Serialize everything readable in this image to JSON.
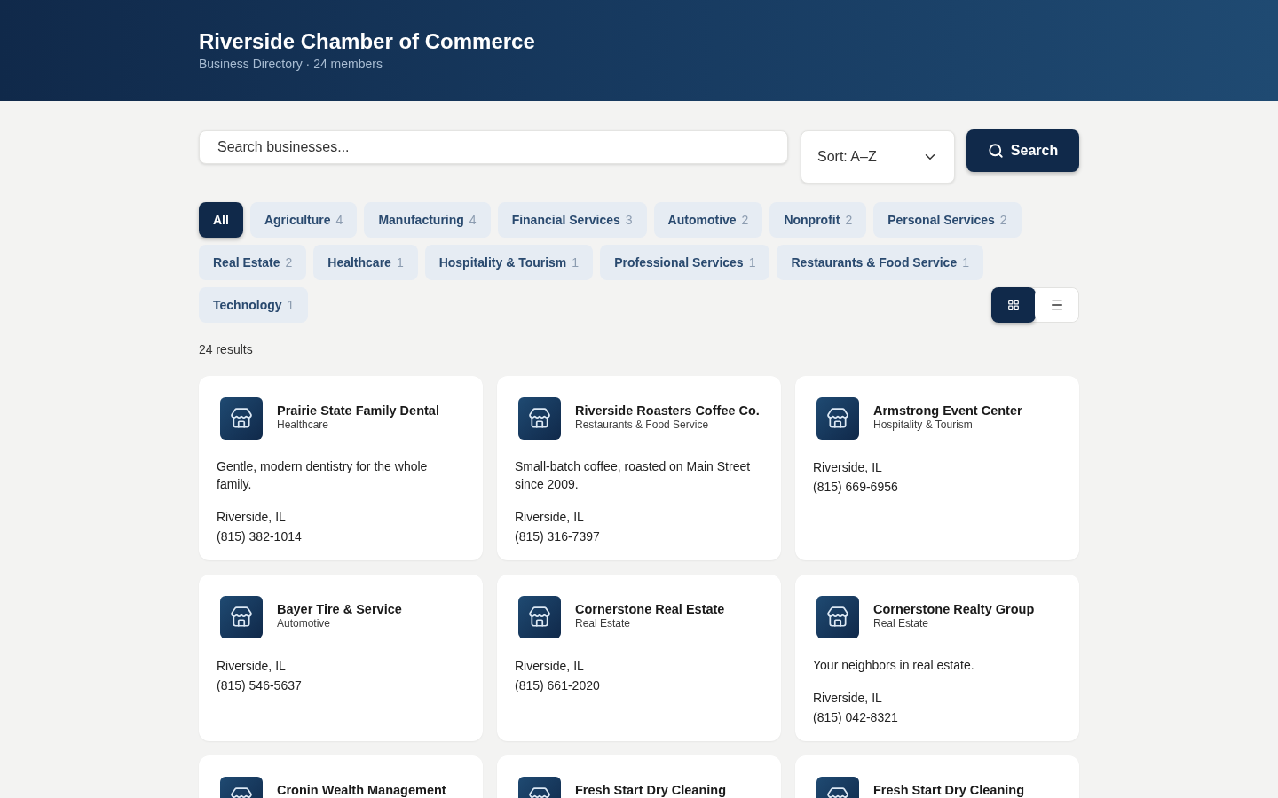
{
  "header": {
    "title": "Riverside Chamber of Commerce",
    "subtitle": "Business Directory · 24 members"
  },
  "search": {
    "placeholder": "Search businesses...",
    "sort": "Sort: A–Z",
    "button": "Search"
  },
  "categories": [
    {
      "label": "All",
      "selected": true
    },
    {
      "label": "Agriculture",
      "count": "4",
      "selected": false
    },
    {
      "label": "Manufacturing",
      "count": "4",
      "selected": false
    },
    {
      "label": "Financial Services",
      "count": "3",
      "selected": false
    },
    {
      "label": "Automotive",
      "count": "2",
      "selected": false
    },
    {
      "label": "Nonprofit",
      "count": "2",
      "selected": false
    },
    {
      "label": "Personal Services",
      "count": "2",
      "selected": false
    },
    {
      "label": "Real Estate",
      "count": "2",
      "selected": false
    },
    {
      "label": "Healthcare",
      "count": "1",
      "selected": false
    },
    {
      "label": "Hospitality & Tourism",
      "count": "1",
      "selected": false
    },
    {
      "label": "Professional Services",
      "count": "1",
      "selected": false
    },
    {
      "label": "Restaurants & Food Service",
      "count": "1",
      "selected": false
    },
    {
      "label": "Technology",
      "count": "1",
      "selected": false
    }
  ],
  "view_toggle": [
    {
      "kind": "grid",
      "selected": true
    },
    {
      "kind": "list",
      "selected": false
    }
  ],
  "results_count": "24 results",
  "businesses": [
    {
      "name": "Prairie State Family Dental",
      "category": "Healthcare",
      "description": "Gentle, modern dentistry for the whole family.",
      "location": "Riverside, IL",
      "phone": "(815) 382-1014"
    },
    {
      "name": "Riverside Roasters Coffee Co.",
      "category": "Restaurants & Food Service",
      "description": "Small-batch coffee, roasted on Main Street since 2009.",
      "location": "Riverside, IL",
      "phone": "(815) 316-7397"
    },
    {
      "name": "Armstrong Event Center",
      "category": "Hospitality & Tourism",
      "location": "Riverside, IL",
      "phone": "(815) 669-6956"
    },
    {
      "name": "Bayer Tire & Service",
      "category": "Automotive",
      "location": "Riverside, IL",
      "phone": "(815) 546-5637"
    },
    {
      "name": "Cornerstone Real Estate",
      "category": "Real Estate",
      "location": "Riverside, IL",
      "phone": "(815) 661-2020"
    },
    {
      "name": "Cornerstone Realty Group",
      "category": "Real Estate",
      "description": "Your neighbors in real estate.",
      "location": "Riverside, IL",
      "phone": "(815) 042-8321"
    },
    {
      "name": "Cronin Wealth Management"
    },
    {
      "name": "Fresh Start Dry Cleaning"
    },
    {
      "name": "Fresh Start Dry Cleaning"
    }
  ]
}
